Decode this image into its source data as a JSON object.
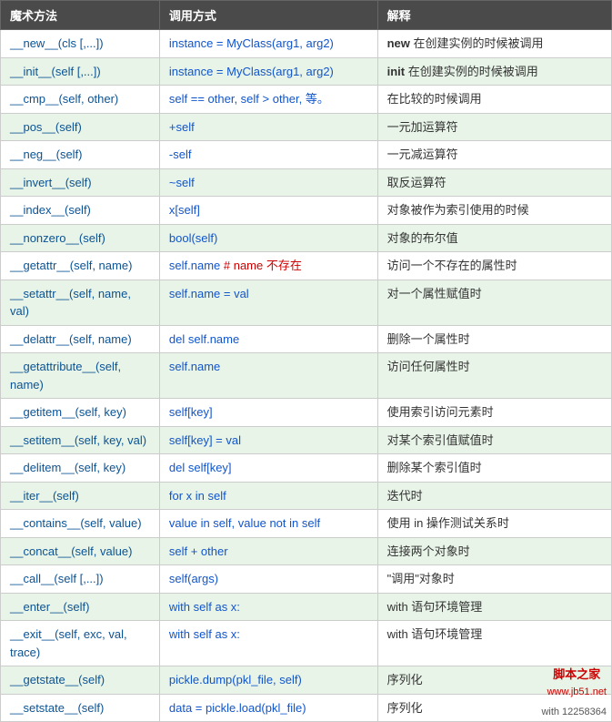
{
  "header": {
    "col1": "魔术方法",
    "col2": "调用方式",
    "col3": "解释"
  },
  "rows": [
    {
      "magic": "__new__(cls [,...])",
      "magic_bold": false,
      "call": "instance = MyClass(arg1, arg2)",
      "explain": "new 在创建实例的时候被调用",
      "explain_bold_prefix": "new"
    },
    {
      "magic": "__init__(self [,...])",
      "magic_bold": false,
      "call": "instance = MyClass(arg1, arg2)",
      "explain": "init 在创建实例的时候被调用",
      "explain_bold_prefix": "init"
    },
    {
      "magic": "__cmp__(self, other)",
      "magic_bold": false,
      "call": "self == other, self > other, 等。",
      "explain": "在比较的时候调用",
      "explain_bold_prefix": ""
    },
    {
      "magic": "__pos__(self)",
      "magic_bold": false,
      "call": "+self",
      "explain": "一元加运算符",
      "explain_bold_prefix": ""
    },
    {
      "magic": "__neg__(self)",
      "magic_bold": false,
      "call": "-self",
      "explain": "一元减运算符",
      "explain_bold_prefix": ""
    },
    {
      "magic": "__invert__(self)",
      "magic_bold": false,
      "call": "~self",
      "explain": "取反运算符",
      "explain_bold_prefix": ""
    },
    {
      "magic": "__index__(self)",
      "magic_bold": false,
      "call": "x[self]",
      "explain": "对象被作为索引使用的时候",
      "explain_bold_prefix": ""
    },
    {
      "magic": "__nonzero__(self)",
      "magic_bold": false,
      "call": "bool(self)",
      "explain": "对象的布尔值",
      "explain_bold_prefix": ""
    },
    {
      "magic": "__getattr__(self, name)",
      "magic_bold": false,
      "call": "self.name # name 不存在",
      "call_has_comment": true,
      "explain": "访问一个不存在的属性时",
      "explain_bold_prefix": ""
    },
    {
      "magic": "__setattr__(self, name, val)",
      "magic_bold": false,
      "call": "self.name = val",
      "explain": "对一个属性赋值时",
      "explain_bold_prefix": ""
    },
    {
      "magic": "__delattr__(self, name)",
      "magic_bold": false,
      "call": "del self.name",
      "explain": "删除一个属性时",
      "explain_bold_prefix": ""
    },
    {
      "magic": "__getattribute__(self, name)",
      "magic_bold": false,
      "call": "self.name",
      "explain": "访问任何属性时",
      "explain_bold_prefix": ""
    },
    {
      "magic": "__getitem__(self, key)",
      "magic_bold": false,
      "call": "self[key]",
      "explain": "使用索引访问元素时",
      "explain_bold_prefix": ""
    },
    {
      "magic": "__setitem__(self, key, val)",
      "magic_bold": false,
      "call": "self[key] = val",
      "explain": "对某个索引值赋值时",
      "explain_bold_prefix": ""
    },
    {
      "magic": "__delitem__(self, key)",
      "magic_bold": false,
      "call": "del self[key]",
      "explain": "删除某个索引值时",
      "explain_bold_prefix": ""
    },
    {
      "magic": "__iter__(self)",
      "magic_bold": false,
      "call": "for x in self",
      "explain": "迭代时",
      "explain_bold_prefix": ""
    },
    {
      "magic": "__contains__(self, value)",
      "magic_bold": false,
      "call": "value in self, value not in self",
      "explain": "使用 in 操作测试关系时",
      "explain_bold_prefix": ""
    },
    {
      "magic": "__concat__(self, value)",
      "magic_bold": false,
      "call": "self + other",
      "explain": "连接两个对象时",
      "explain_bold_prefix": ""
    },
    {
      "magic": "__call__(self [,...])",
      "magic_bold": false,
      "call": "self(args)",
      "explain": "\"调用\"对象时",
      "explain_bold_prefix": ""
    },
    {
      "magic": "__enter__(self)",
      "magic_bold": false,
      "call": "with self as x:",
      "explain": "with 语句环境管理",
      "explain_bold_prefix": ""
    },
    {
      "magic": "__exit__(self, exc, val, trace)",
      "magic_bold": false,
      "call": "with self as x:",
      "explain": "with 语句环境管理",
      "explain_bold_prefix": ""
    },
    {
      "magic": "__getstate__(self)",
      "magic_bold": false,
      "call": "pickle.dump(pkl_file, self)",
      "explain": "序列化",
      "explain_bold_prefix": "",
      "has_watermark": true
    },
    {
      "magic": "__setstate__(self)",
      "magic_bold": false,
      "call": "data = pickle.load(pkl_file)",
      "explain": "序列化",
      "explain_bold_prefix": "",
      "has_watermark_sub": true
    }
  ],
  "watermark": {
    "line1": "脚本之家",
    "line2": "www.jb51.net",
    "extra": "with 12258364"
  }
}
